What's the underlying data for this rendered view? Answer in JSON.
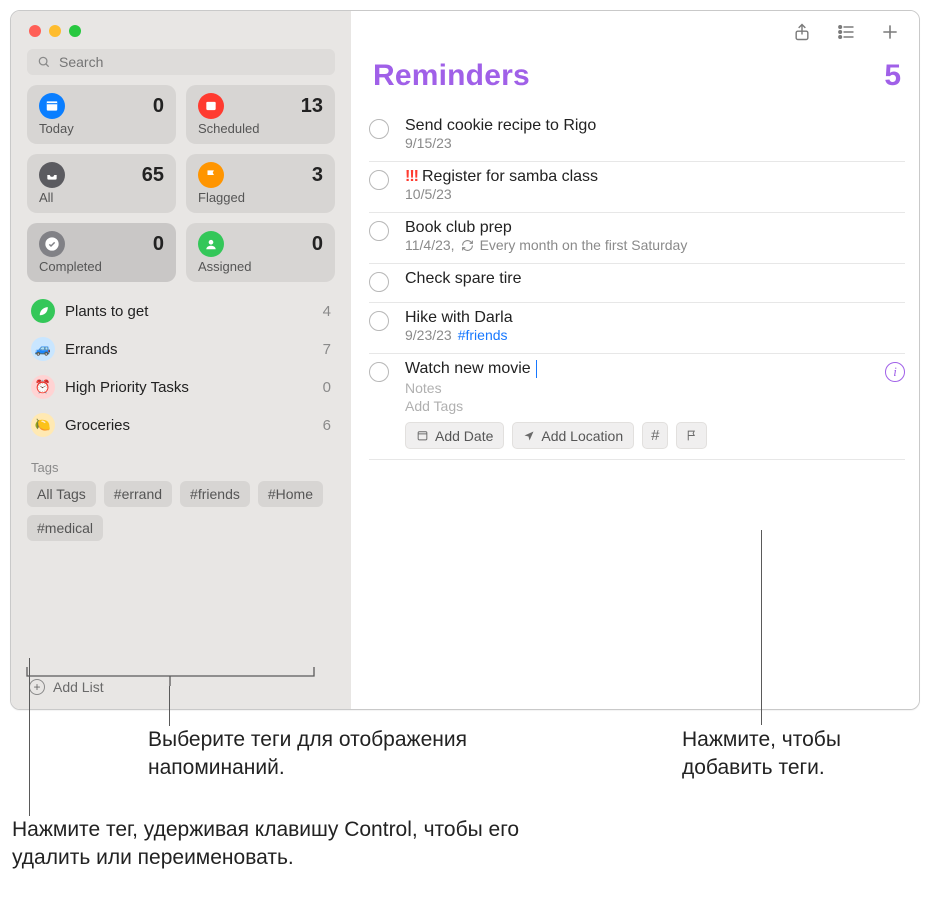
{
  "sidebar": {
    "search_placeholder": "Search",
    "cards": [
      {
        "label": "Today",
        "count": "0"
      },
      {
        "label": "Scheduled",
        "count": "13"
      },
      {
        "label": "All",
        "count": "65"
      },
      {
        "label": "Flagged",
        "count": "3"
      },
      {
        "label": "Completed",
        "count": "0"
      },
      {
        "label": "Assigned",
        "count": "0"
      }
    ],
    "lists": [
      {
        "name": "Plants to get",
        "count": "4"
      },
      {
        "name": "Errands",
        "count": "7"
      },
      {
        "name": "High Priority Tasks",
        "count": "0"
      },
      {
        "name": "Groceries",
        "count": "6"
      }
    ],
    "tags_heading": "Tags",
    "tags": [
      "All Tags",
      "#errand",
      "#friends",
      "#Home",
      "#medical"
    ],
    "add_list_label": "Add List"
  },
  "main": {
    "title": "Reminders",
    "count": "5",
    "reminders": [
      {
        "title": "Send cookie recipe to Rigo",
        "subtitle": "9/15/23"
      },
      {
        "priority": "!!!",
        "title": "Register for samba class",
        "subtitle": "10/5/23"
      },
      {
        "title": "Book club prep",
        "subtitle": "11/4/23,",
        "repeat": "Every month on the first Saturday"
      },
      {
        "title": "Check spare tire"
      },
      {
        "title": "Hike with Darla",
        "subtitle": "9/23/23",
        "tag": "#friends"
      }
    ],
    "editing": {
      "title": "Watch new movie",
      "notes_placeholder": "Notes",
      "addtags_placeholder": "Add Tags",
      "chips": {
        "date": "Add Date",
        "location": "Add Location"
      }
    }
  },
  "annotations": {
    "select_tags": "Выберите теги для отображения напоминаний.",
    "ctrl_click": "Нажмите тег, удерживая клавишу Control, чтобы его удалить или переименовать.",
    "click_add_tags_1": "Нажмите, чтобы",
    "click_add_tags_2": "добавить теги."
  }
}
